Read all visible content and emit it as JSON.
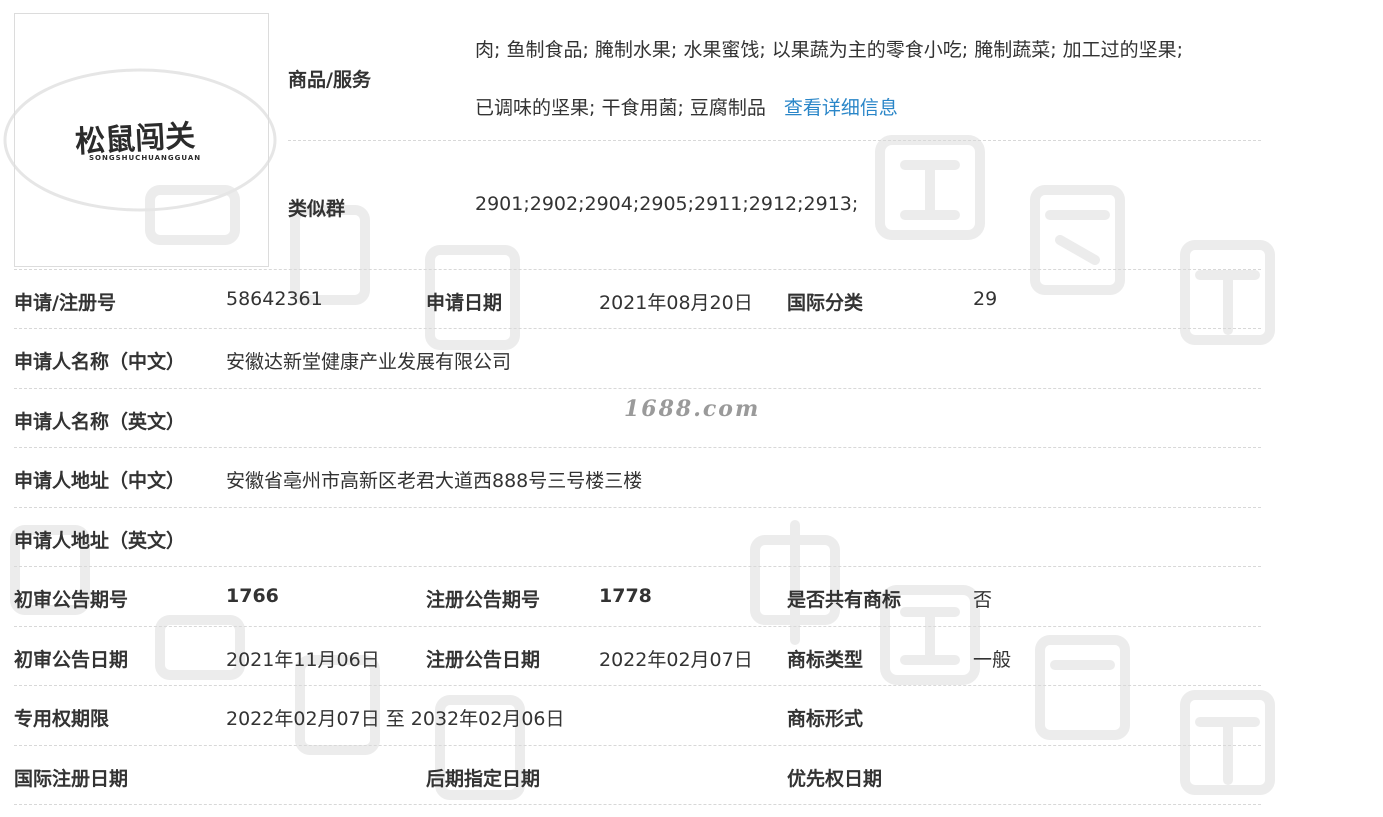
{
  "logo": {
    "text": "松鼠闯关",
    "subtext": "SONGSHUCHUANGGUAN"
  },
  "goods": {
    "label": "商品/服务",
    "line1": "肉; 鱼制食品; 腌制水果; 水果蜜饯; 以果蔬为主的零食小吃; 腌制蔬菜; 加工过的坚果;",
    "line2": "已调味的坚果; 干食用菌; 豆腐制品",
    "more_link": "查看详细信息"
  },
  "similar_group": {
    "label": "类似群",
    "value": "2901;2902;2904;2905;2911;2912;2913;"
  },
  "rows": {
    "reg_no": {
      "label": "申请/注册号",
      "value": "58642361"
    },
    "apply_date": {
      "label": "申请日期",
      "value": "2021年08月20日"
    },
    "intl_class": {
      "label": "国际分类",
      "value": "29"
    },
    "applicant_cn": {
      "label": "申请人名称（中文）",
      "value": "安徽达新堂健康产业发展有限公司"
    },
    "applicant_en": {
      "label": "申请人名称（英文）",
      "value": ""
    },
    "address_cn": {
      "label": "申请人地址（中文）",
      "value": "安徽省亳州市高新区老君大道西888号三号楼三楼"
    },
    "address_en": {
      "label": "申请人地址（英文）",
      "value": ""
    },
    "prelim_issue": {
      "label": "初审公告期号",
      "value": "1766"
    },
    "reg_issue": {
      "label": "注册公告期号",
      "value": "1778"
    },
    "shared": {
      "label": "是否共有商标",
      "value": "否"
    },
    "prelim_date": {
      "label": "初审公告日期",
      "value": "2021年11月06日"
    },
    "reg_date": {
      "label": "注册公告日期",
      "value": "2022年02月07日"
    },
    "mark_type": {
      "label": "商标类型",
      "value": "一般"
    },
    "exclusive_period": {
      "label": "专用权期限",
      "value": "2022年02月07日 至 2032年02月06日"
    },
    "mark_form": {
      "label": "商标形式",
      "value": ""
    },
    "intl_reg_date": {
      "label": "国际注册日期",
      "value": ""
    },
    "later_designation": {
      "label": "后期指定日期",
      "value": ""
    },
    "priority_date": {
      "label": "优先权日期",
      "value": ""
    }
  },
  "watermark": {
    "site": "1688.com",
    "chars": [
      "中",
      "国",
      "商",
      "标"
    ]
  }
}
